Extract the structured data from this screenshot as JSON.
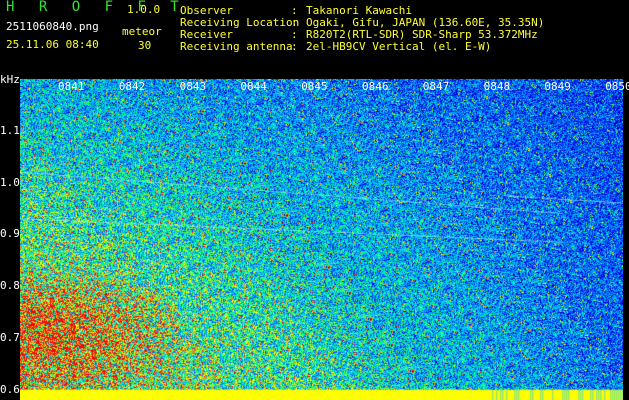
{
  "header": {
    "app_logo": "H R O F F T",
    "app_version": "1.0.0",
    "file_name": "2511060840.png",
    "mode_label": "meteor",
    "date_time": "25.11.06 08:40",
    "count_value": "30"
  },
  "station_info": [
    {
      "key": "Observer",
      "sep": ":",
      "value": "Takanori Kawachi"
    },
    {
      "key": "Receiving Location",
      "sep": ":",
      "value": "Ogaki, Gifu, JAPAN (136.60E, 35.35N)"
    },
    {
      "key": "Receiver",
      "sep": ":",
      "value": "R820T2(RTL-SDR) SDR-Sharp 53.372MHz"
    },
    {
      "key": "Receiving antenna",
      "sep": ":",
      "value": "2el-HB9CV Vertical (el. E-W)"
    }
  ],
  "chart_data": {
    "type": "heatmap",
    "title": "",
    "xlabel": "",
    "ylabel": "kHz",
    "x_ticks": [
      "0841",
      "0842",
      "0843",
      "0844",
      "0845",
      "0846",
      "0847",
      "0848",
      "0849",
      "0850"
    ],
    "y_ticks": [
      "1.1",
      "1.0",
      "0.9",
      "0.8",
      "0.7",
      "0.6"
    ],
    "ylim": [
      0.58,
      1.2
    ],
    "colormap": [
      "#00008b",
      "#0000ff",
      "#00bfff",
      "#00ff80",
      "#ffff00",
      "#ff0000"
    ],
    "background_color": "#0a0a8a",
    "baseline_band_color": "#ffff00",
    "signal_lines": [
      {
        "start_time": "08:40",
        "end_time": "08:49",
        "freq_start": 0.93,
        "freq_end": 0.885
      },
      {
        "start_time": "08:40",
        "end_time": "08:49",
        "freq_start": 1.02,
        "freq_end": 0.94
      },
      {
        "start_time": "08:48",
        "end_time": "08:50",
        "freq_start": 0.975,
        "freq_end": 0.96
      }
    ]
  },
  "colors": {
    "header_green": "#34e234",
    "header_yellow": "#ffff33",
    "label_white": "#ffffff"
  }
}
